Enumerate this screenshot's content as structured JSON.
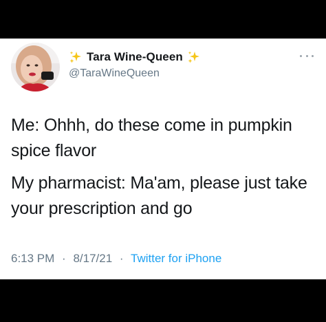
{
  "user": {
    "display_name": "Tara Wine-Queen",
    "handle": "@TaraWineQueen",
    "name_decoration": "sparkles-icon"
  },
  "tweet": {
    "lines": [
      "Me: Ohhh, do these come in pumpkin spice flavor",
      "My pharmacist: Ma'am, please just take your prescription and go"
    ],
    "time": "6:13 PM",
    "date": "8/17/21",
    "separator": "·",
    "source": "Twitter for iPhone"
  },
  "icons": {
    "more": "more-horizontal-icon"
  },
  "colors": {
    "background": "#000000",
    "card": "#ffffff",
    "text": "#14171a",
    "secondary": "#657786",
    "link": "#1da1f2",
    "sparkle": "#f5c518"
  }
}
